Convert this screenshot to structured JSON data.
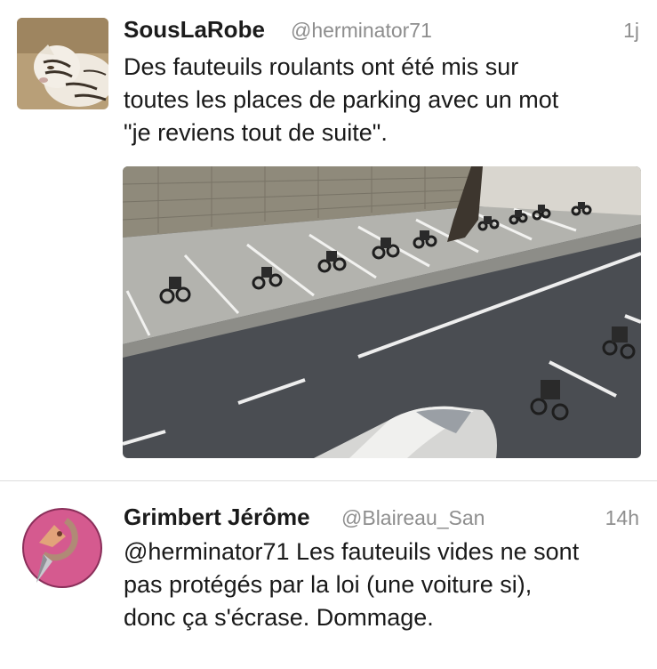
{
  "tweets": [
    {
      "name": "SousLaRobe",
      "handle": "@herminator71",
      "time": "1j",
      "lines": [
        "Des fauteuils roulants ont été mis sur",
        "toutes les places de parking avec un mot",
        "\"je reviens tout de suite\"."
      ],
      "avatar_icon": "white-tiger-avatar",
      "photo_icon": "wheelchairs-parking-photo"
    },
    {
      "name": "Grimbert Jérôme",
      "handle": "@Blaireau_San",
      "time": "14h",
      "lines": [
        "@herminator71 Les fauteuils vides ne sont",
        "pas protégés par la loi (une voiture si),",
        "donc ça s'écrase. Dommage."
      ],
      "avatar_icon": "pink-pin-avatar"
    }
  ],
  "colors": {
    "name": "#1b1b1b",
    "meta": "#8e8e8e",
    "separator": "#dcdcdc",
    "avatar2_bg": "#d55a8f"
  }
}
